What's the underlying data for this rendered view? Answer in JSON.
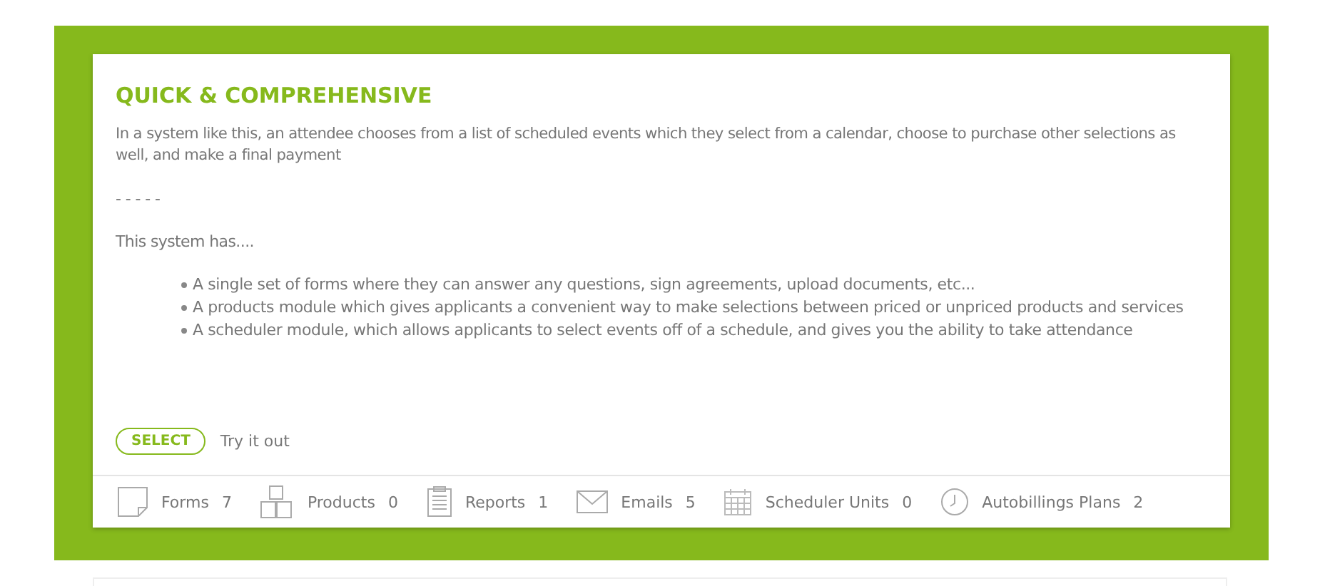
{
  "card": {
    "title": "QUICK & COMPREHENSIVE",
    "description": "In a system like this, an attendee chooses from a list of scheduled events which they select from a calendar, choose to purchase other selections as well, and make a final payment",
    "separator": "- - - - -",
    "intro": "This system has....",
    "bullets": [
      "A single set of forms where they can answer any questions, sign agreements, upload documents, etc...",
      "A products module which gives applicants a convenient way to make selections between priced or unpriced products and services",
      "A scheduler module, which allows applicants to select events off of a schedule, and gives you the ability to take attendance"
    ],
    "select_button": "SELECT",
    "try_link": "Try it out",
    "stats": [
      {
        "kind": "forms",
        "label": "Forms",
        "count": "7"
      },
      {
        "kind": "products",
        "label": "Products",
        "count": "0"
      },
      {
        "kind": "reports",
        "label": "Reports",
        "count": "1"
      },
      {
        "kind": "emails",
        "label": "Emails",
        "count": "5"
      },
      {
        "kind": "scheduler",
        "label": "Scheduler Units",
        "count": "0"
      },
      {
        "kind": "autobilling",
        "label": "Autobillings Plans",
        "count": "2"
      }
    ]
  }
}
